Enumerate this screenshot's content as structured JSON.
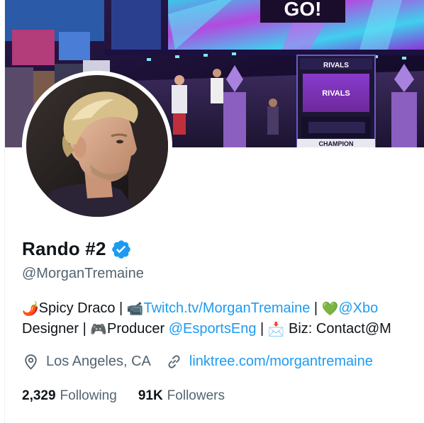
{
  "profile": {
    "display_name": "Rando #2",
    "verified": true,
    "handle": "@MorganTremaine",
    "bio": {
      "line1": {
        "emoji1": "🌶️",
        "text1": "Spicy Draco | ",
        "emoji2": "📹",
        "link1": "Twitch.tv/MorganTremaine",
        "sep": " | ",
        "emoji3": "💚",
        "link2": "@Xbo"
      },
      "line2": {
        "text1": "Designer | ",
        "emoji1": "🎮",
        "text2": "Producer ",
        "link1": "@EsportsEng",
        "sep": " | ",
        "emoji2": "📩",
        "text3": " Biz: Contact@M"
      }
    },
    "location": "Los Angeles, CA",
    "website": "linktree.com/morgantremaine",
    "following_count": "2,329",
    "following_label": "Following",
    "followers_count": "91K",
    "followers_label": "Followers"
  },
  "banner": {
    "sign_text": "GO!",
    "arcade_label": "RIVALS",
    "arcade_screen_label": "RIVALS",
    "lower_sign": "CHAMPION"
  },
  "colors": {
    "accent": "#1d9bf0",
    "secondary_text": "#536471",
    "primary_text": "#0f1419"
  },
  "icons": {
    "verified": "verified-badge-icon",
    "location": "location-pin-icon",
    "website": "link-icon"
  }
}
